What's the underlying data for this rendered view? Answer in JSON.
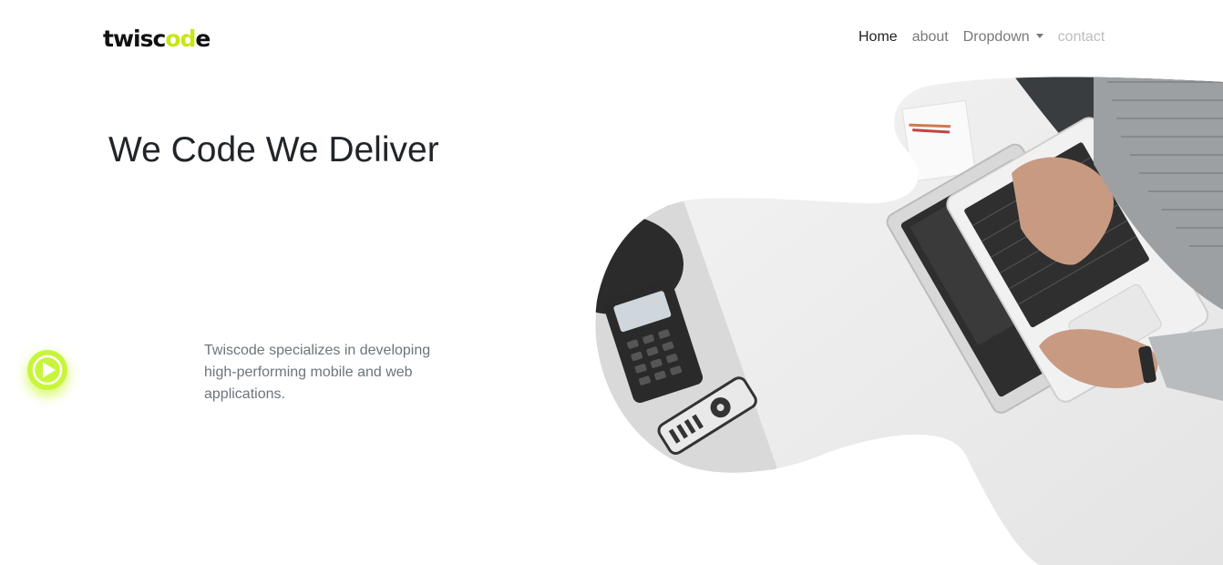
{
  "logo": {
    "prefix": "twisc",
    "accent": "od",
    "suffix": "e",
    "accent_color": "#c8e615"
  },
  "nav": {
    "home": "Home",
    "about": "about",
    "dropdown": "Dropdown",
    "contact": "contact"
  },
  "hero": {
    "title": "We Code We Deliver",
    "description": "Twiscode specializes in developing high-performing mobile and web applications."
  },
  "play_button": {
    "icon": "play-icon",
    "color": "#c8f53c"
  },
  "hero_image": {
    "subject": "laptop-desk-photo"
  }
}
